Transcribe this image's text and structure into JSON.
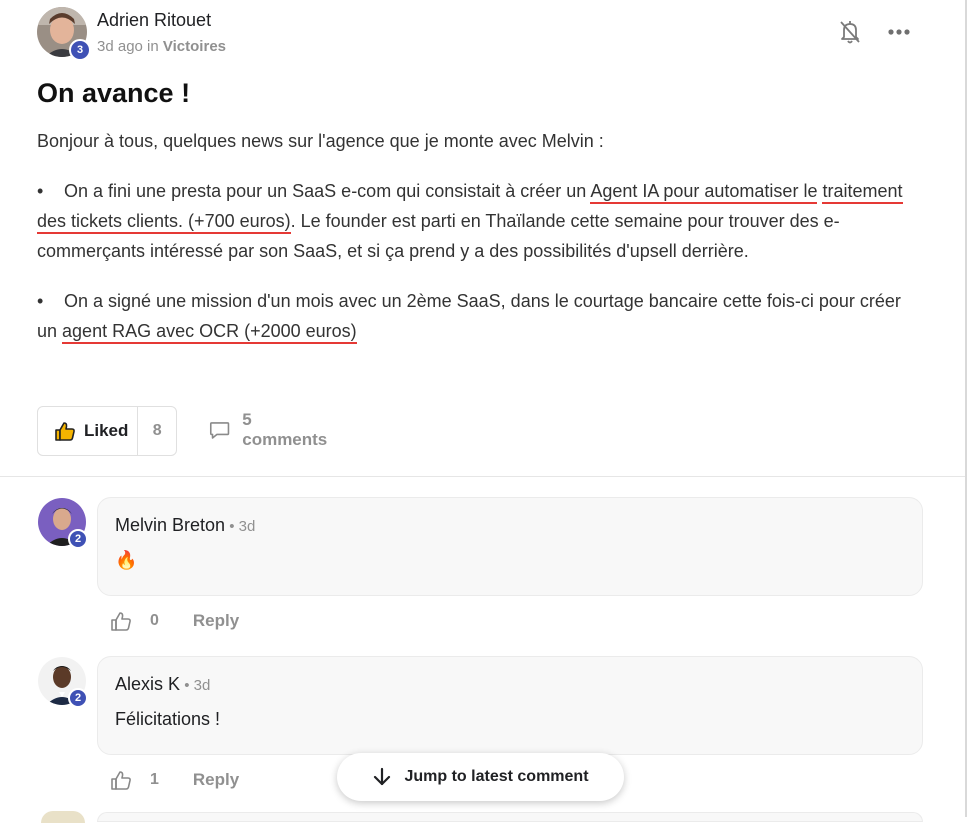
{
  "post": {
    "author": "Adrien Ritouet",
    "author_level": "3",
    "time": "3d ago",
    "in_label": " in ",
    "category": "Victoires",
    "title": "On avance !",
    "intro": "Bonjour à tous, quelques news sur l'agence que je monte avec Melvin :",
    "bullet_char": "•",
    "bullet1": {
      "before": "On a fini une presta pour un SaaS e-com qui consistait à créer un ",
      "highlight_a": "Agent IA pour automatiser le",
      "highlight_b": "traitement des tickets clients. (+700 euros)",
      "after": ". Le founder est parti en Thaïlande cette semaine pour trouver des e-commerçants intéressé par son SaaS, et si ça prend y a des possibilités d'upsell derrière."
    },
    "bullet2": {
      "before": "On a signé une mission d'un mois avec un 2ème SaaS, dans le courtage bancaire cette fois-ci pour créer un ",
      "highlight": "agent RAG avec OCR (+2000 euros)"
    },
    "liked_label": "Liked",
    "like_count": "8",
    "comments_label": "5 comments"
  },
  "comments": [
    {
      "author": "Melvin Breton",
      "level": "2",
      "time": " • 3d",
      "text": "🔥",
      "likes": "0",
      "reply_label": "Reply"
    },
    {
      "author": "Alexis K",
      "level": "2",
      "time": " • 3d",
      "text": "Félicitations !",
      "likes": "1",
      "reply_label": "Reply"
    }
  ],
  "jump_label": "Jump to latest comment",
  "icons": {
    "bell": "bell-off-icon",
    "more": "more-horizontal-icon",
    "like": "thumbs-up-icon",
    "comment": "comment-icon",
    "arrow": "arrow-down-icon"
  },
  "colors": {
    "level_badge": "#3f51b5",
    "highlight_underline": "#e53935",
    "muted_text": "#909090",
    "like_icon": "#f5b400"
  }
}
